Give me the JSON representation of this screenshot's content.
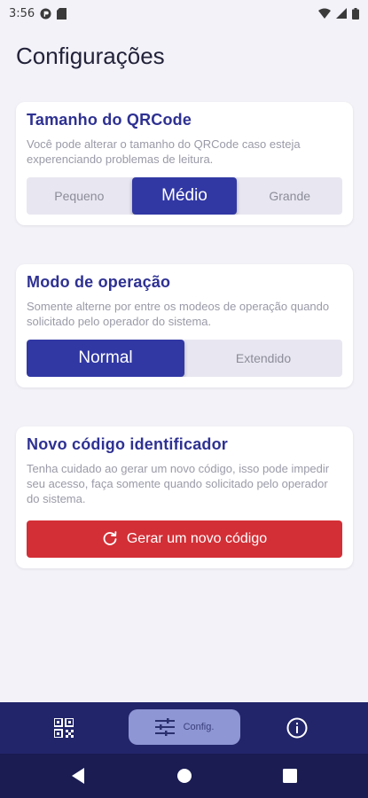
{
  "status_bar": {
    "time": "3:56",
    "icons": [
      "app-notification-icon",
      "sd-card-icon",
      "wifi-icon",
      "signal-icon",
      "battery-icon"
    ]
  },
  "page": {
    "title": "Configurações"
  },
  "qrcode_size": {
    "title": "Tamanho do QRCode",
    "description": "Você pode alterar o tamanho do QRCode caso esteja experenciando problemas de leitura.",
    "options": [
      "Pequeno",
      "Médio",
      "Grande"
    ],
    "selected": "Médio"
  },
  "operation_mode": {
    "title": "Modo de operação",
    "description": "Somente alterne por entre os modeos de operação quando solicitado pelo operador do sistema.",
    "options": [
      "Normal",
      "Extendido"
    ],
    "selected": "Normal"
  },
  "new_code": {
    "title": "Novo código identificador",
    "description": "Tenha cuidado ao gerar um novo código, isso pode impedir seu acesso, faça somente quando solicitado pelo operador do sistema.",
    "button_label": "Gerar um novo código",
    "button_icon": "refresh-icon"
  },
  "bottom_nav": {
    "items": [
      {
        "icon": "qrcode-icon",
        "label": ""
      },
      {
        "icon": "sliders-icon",
        "label": "Config."
      },
      {
        "icon": "info-icon",
        "label": ""
      }
    ],
    "active": "Config."
  },
  "colors": {
    "primary": "#3138a4",
    "danger": "#d32f36",
    "nav_background": "#22256a",
    "nav_active": "#8e96d4",
    "background": "#f3f2f8"
  }
}
